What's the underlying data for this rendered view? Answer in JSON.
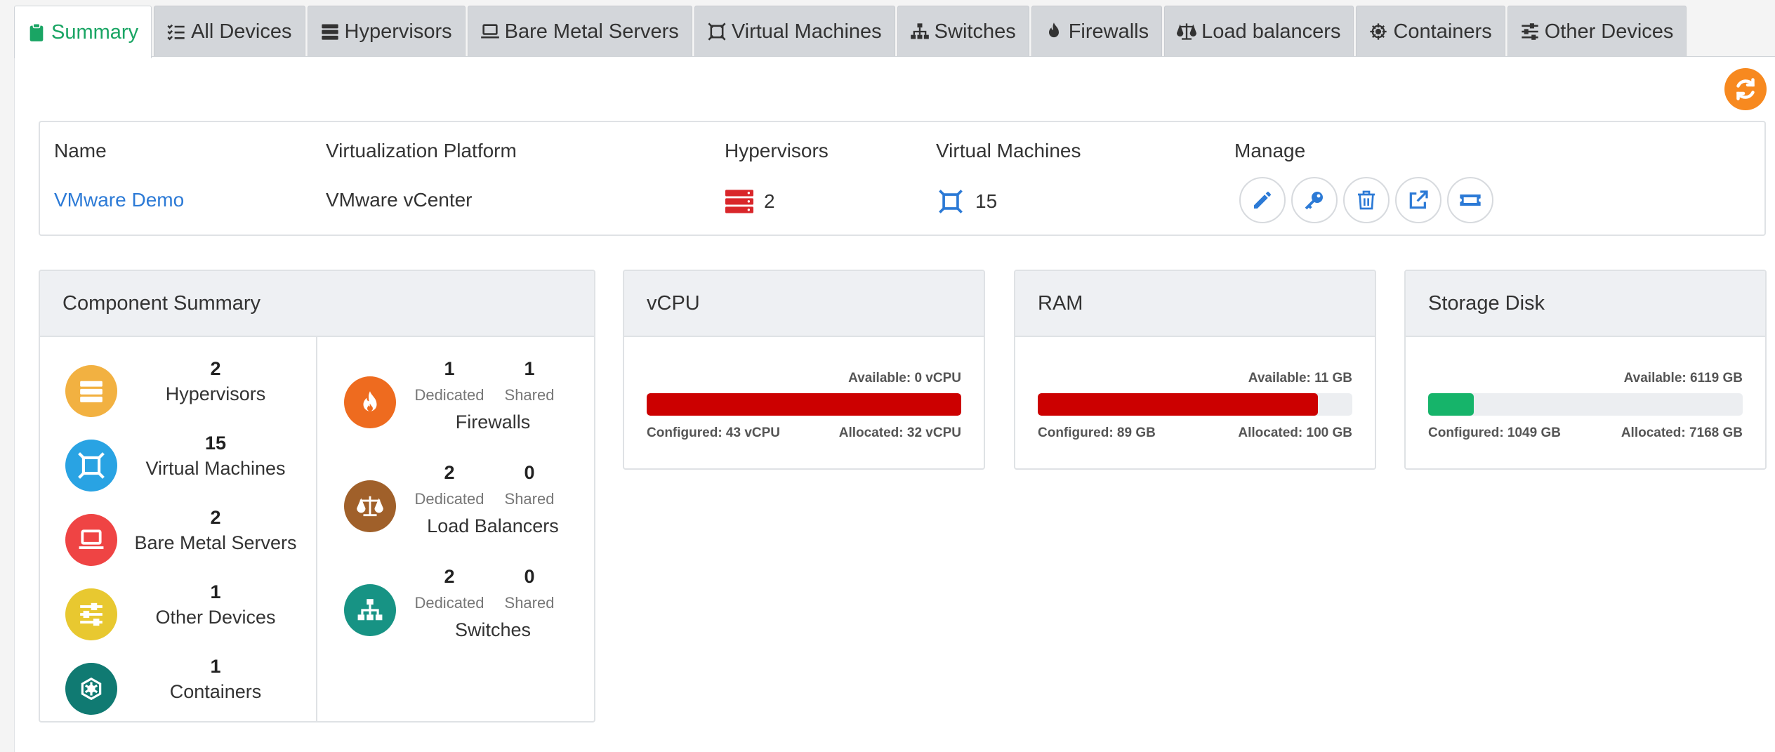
{
  "tabs": [
    {
      "label": "Summary",
      "icon": "clipboard-icon",
      "active": true
    },
    {
      "label": "All Devices",
      "icon": "list-check-icon"
    },
    {
      "label": "Hypervisors",
      "icon": "server-icon"
    },
    {
      "label": "Bare Metal Servers",
      "icon": "laptop-icon"
    },
    {
      "label": "Virtual Machines",
      "icon": "vm-icon"
    },
    {
      "label": "Switches",
      "icon": "sitemap-icon"
    },
    {
      "label": "Firewalls",
      "icon": "fire-icon"
    },
    {
      "label": "Load balancers",
      "icon": "balance-scale-icon"
    },
    {
      "label": "Containers",
      "icon": "helm-icon"
    },
    {
      "label": "Other Devices",
      "icon": "sliders-icon"
    }
  ],
  "info": {
    "headers": {
      "name": "Name",
      "platform": "Virtualization Platform",
      "hypervisors": "Hypervisors",
      "vms": "Virtual Machines",
      "manage": "Manage"
    },
    "row": {
      "name": "VMware Demo",
      "platform": "VMware vCenter",
      "hypervisors": "2",
      "vms": "15"
    }
  },
  "component_summary": {
    "title": "Component Summary",
    "items": [
      {
        "count": "2",
        "label": "Hypervisors"
      },
      {
        "count": "15",
        "label": "Virtual Machines"
      },
      {
        "count": "2",
        "label": "Bare Metal Servers"
      },
      {
        "count": "1",
        "label": "Other Devices"
      },
      {
        "count": "1",
        "label": "Containers"
      }
    ],
    "network": [
      {
        "dedicated": "1",
        "shared": "1",
        "dedicated_label": "Dedicated",
        "shared_label": "Shared",
        "label": "Firewalls"
      },
      {
        "dedicated": "2",
        "shared": "0",
        "dedicated_label": "Dedicated",
        "shared_label": "Shared",
        "label": "Load Balancers"
      },
      {
        "dedicated": "2",
        "shared": "0",
        "dedicated_label": "Dedicated",
        "shared_label": "Shared",
        "label": "Switches"
      }
    ]
  },
  "resources": [
    {
      "title": "vCPU",
      "available": "Available: 0 vCPU",
      "configured": "Configured: 43 vCPU",
      "allocated": "Allocated: 32 vCPU",
      "fill_percent": 100,
      "color": "#cc0000"
    },
    {
      "title": "RAM",
      "available": "Available: 11 GB",
      "configured": "Configured: 89 GB",
      "allocated": "Allocated: 100 GB",
      "fill_percent": 89,
      "color": "#cc0000"
    },
    {
      "title": "Storage Disk",
      "available": "Available: 6119 GB",
      "configured": "Configured: 1049 GB",
      "allocated": "Allocated: 7168 GB",
      "fill_percent": 14.6,
      "color": "#16b46a"
    }
  ],
  "colors": {
    "accent_green": "#1aa564",
    "link_blue": "#2c7ad6",
    "refresh_orange": "#f7891f",
    "hypervisor_orange": "#f2b141",
    "vm_blue": "#29a3e3",
    "baremetal_red": "#ef4444",
    "other_yellow": "#e8c830",
    "container_teal": "#107a72",
    "firewall_orange": "#ee6b1f",
    "lb_brown": "#a0602a",
    "switch_teal": "#179384",
    "danger_red": "#cc0000"
  }
}
